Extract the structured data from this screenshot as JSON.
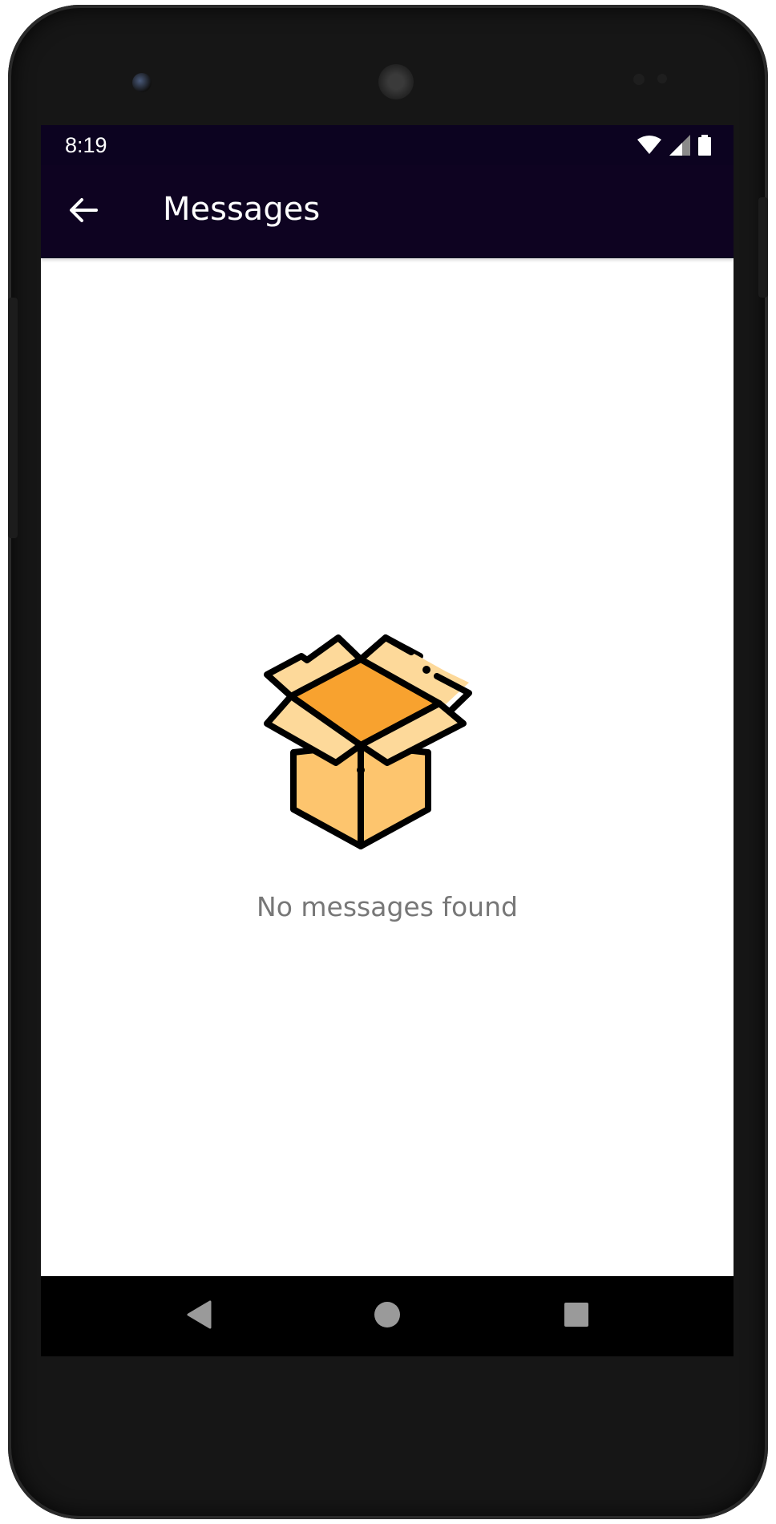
{
  "status_bar": {
    "time": "8:19",
    "icons": [
      "wifi-icon",
      "signal-icon",
      "battery-icon"
    ]
  },
  "app_bar": {
    "back_icon": "arrow-left-icon",
    "title": "Messages"
  },
  "empty_state": {
    "icon": "open-box-icon",
    "message": "No messages found"
  },
  "nav_bar": {
    "buttons": [
      "back-triangle-icon",
      "home-circle-icon",
      "recents-square-icon"
    ]
  },
  "colors": {
    "app_bar_bg": "#0e0321",
    "status_bar_bg": "#0c0320",
    "box_dark": "#f8a22f",
    "box_mid": "#fdc56e",
    "box_light": "#fdd99a"
  }
}
